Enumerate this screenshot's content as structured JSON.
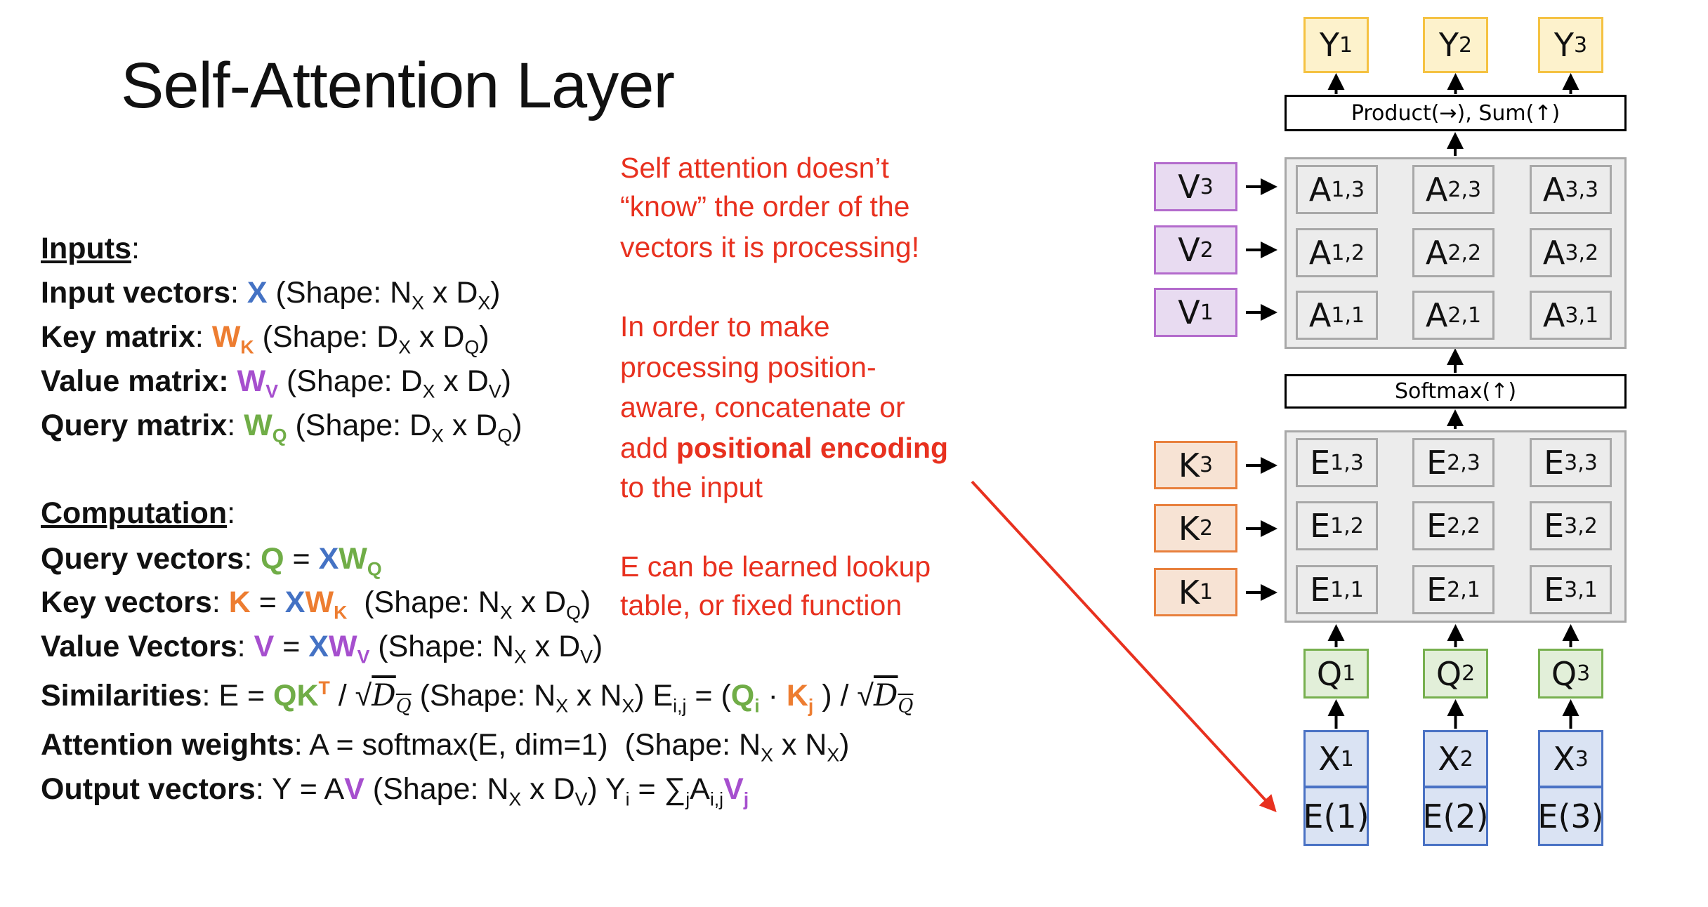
{
  "title": "Self-Attention Layer",
  "colors": {
    "blue": "#4472c4",
    "orange": "#ed7d31",
    "purple": "#a64fce",
    "green": "#70ad47",
    "red": "#e8311f"
  },
  "left_text": {
    "lines": [
      [
        {
          "t": "Inputs",
          "b": 1,
          "u": 1
        },
        {
          "t": ":"
        }
      ],
      [
        {
          "t": "Input vectors",
          "b": 1
        },
        {
          "t": ": "
        },
        {
          "t": "X",
          "b": 1,
          "c": "#4472c4"
        },
        {
          "t": " (Shape: N"
        },
        {
          "t": "X",
          "sub": 1
        },
        {
          "t": " x D"
        },
        {
          "t": "X",
          "sub": 1
        },
        {
          "t": ")"
        }
      ],
      [
        {
          "t": "Key matrix",
          "b": 1
        },
        {
          "t": ": "
        },
        {
          "t": "W",
          "b": 1,
          "c": "#ed7d31"
        },
        {
          "t": "K",
          "b": 1,
          "sub": 1,
          "c": "#ed7d31"
        },
        {
          "t": " (Shape: D"
        },
        {
          "t": "X",
          "sub": 1
        },
        {
          "t": " x D"
        },
        {
          "t": "Q",
          "sub": 1
        },
        {
          "t": ")"
        }
      ],
      [
        {
          "t": "Value matrix:",
          "b": 1
        },
        {
          "t": " "
        },
        {
          "t": "W",
          "b": 1,
          "c": "#a64fce"
        },
        {
          "t": "V",
          "b": 1,
          "sub": 1,
          "c": "#a64fce"
        },
        {
          "t": " (Shape: D"
        },
        {
          "t": "X",
          "sub": 1
        },
        {
          "t": " x D"
        },
        {
          "t": "V",
          "sub": 1
        },
        {
          "t": ")"
        }
      ],
      [
        {
          "t": "Query matrix",
          "b": 1
        },
        {
          "t": ": "
        },
        {
          "t": "W",
          "b": 1,
          "c": "#70ad47"
        },
        {
          "t": "Q",
          "b": 1,
          "sub": 1,
          "c": "#70ad47"
        },
        {
          "t": " (Shape: D"
        },
        {
          "t": "X",
          "sub": 1
        },
        {
          "t": " x D"
        },
        {
          "t": "Q",
          "sub": 1
        },
        {
          "t": ")"
        }
      ],
      [
        {
          "t": "Computation",
          "b": 1,
          "u": 1
        },
        {
          "t": ":"
        }
      ],
      [
        {
          "t": "Query vectors",
          "b": 1
        },
        {
          "t": ": "
        },
        {
          "t": "Q",
          "b": 1,
          "c": "#70ad47"
        },
        {
          "t": " = "
        },
        {
          "t": "X",
          "b": 1,
          "c": "#4472c4"
        },
        {
          "t": "W",
          "b": 1,
          "c": "#70ad47"
        },
        {
          "t": "Q",
          "b": 1,
          "sub": 1,
          "c": "#70ad47"
        }
      ],
      [
        {
          "t": "Key vectors",
          "b": 1
        },
        {
          "t": ": "
        },
        {
          "t": "K",
          "b": 1,
          "c": "#ed7d31"
        },
        {
          "t": " = "
        },
        {
          "t": "X",
          "b": 1,
          "c": "#4472c4"
        },
        {
          "t": "W",
          "b": 1,
          "c": "#ed7d31"
        },
        {
          "t": "K",
          "b": 1,
          "sub": 1,
          "c": "#ed7d31"
        },
        {
          "t": "  (Shape: N"
        },
        {
          "t": "X",
          "sub": 1
        },
        {
          "t": " x D"
        },
        {
          "t": "Q",
          "sub": 1
        },
        {
          "t": ")"
        }
      ],
      [
        {
          "t": "Value Vectors",
          "b": 1
        },
        {
          "t": ": "
        },
        {
          "t": "V",
          "b": 1,
          "c": "#a64fce"
        },
        {
          "t": " = "
        },
        {
          "t": "X",
          "b": 1,
          "c": "#4472c4"
        },
        {
          "t": "W",
          "b": 1,
          "c": "#a64fce"
        },
        {
          "t": "V",
          "b": 1,
          "sub": 1,
          "c": "#a64fce"
        },
        {
          "t": " (Shape: N"
        },
        {
          "t": "X",
          "sub": 1
        },
        {
          "t": " x D"
        },
        {
          "t": "V",
          "sub": 1
        },
        {
          "t": ")"
        }
      ],
      [
        {
          "t": "Similarities",
          "b": 1
        },
        {
          "t": ": E = "
        },
        {
          "t": "QK",
          "b": 1,
          "c": "#70ad47"
        },
        {
          "t": "T",
          "b": 1,
          "sup": 1,
          "c": "#ed7d31"
        },
        {
          "t": " / √"
        },
        {
          "t": "D",
          "it": 1,
          "ov": 1
        },
        {
          "t": "Q",
          "it": 1,
          "ov": 1,
          "sub": 1
        },
        {
          "t": " (Shape: N"
        },
        {
          "t": "X",
          "sub": 1
        },
        {
          "t": " x N"
        },
        {
          "t": "X",
          "sub": 1
        },
        {
          "t": ") E"
        },
        {
          "t": "i,j",
          "sub": 1
        },
        {
          "t": " = ("
        },
        {
          "t": "Q",
          "b": 1,
          "c": "#70ad47"
        },
        {
          "t": "i",
          "b": 1,
          "sub": 1,
          "c": "#70ad47"
        },
        {
          "t": " · "
        },
        {
          "t": "K",
          "b": 1,
          "c": "#ed7d31"
        },
        {
          "t": "j",
          "b": 1,
          "sub": 1,
          "c": "#ed7d31"
        },
        {
          "t": " ) / √"
        },
        {
          "t": "D",
          "it": 1,
          "ov": 1
        },
        {
          "t": "Q",
          "it": 1,
          "ov": 1,
          "sub": 1
        }
      ],
      [
        {
          "t": "Attention weights",
          "b": 1
        },
        {
          "t": ": A = softmax(E, dim=1)  (Shape: N"
        },
        {
          "t": "X",
          "sub": 1
        },
        {
          "t": " x N"
        },
        {
          "t": "X",
          "sub": 1
        },
        {
          "t": ")"
        }
      ],
      [
        {
          "t": "Output vectors",
          "b": 1
        },
        {
          "t": ": Y = A"
        },
        {
          "t": "V",
          "b": 1,
          "c": "#a64fce"
        },
        {
          "t": " (Shape: N"
        },
        {
          "t": "X",
          "sub": 1
        },
        {
          "t": " x D"
        },
        {
          "t": "V",
          "sub": 1
        },
        {
          "t": ") Y"
        },
        {
          "t": "i",
          "sub": 1
        },
        {
          "t": " = ∑"
        },
        {
          "t": "j",
          "sub": 1
        },
        {
          "t": "A"
        },
        {
          "t": "i,j",
          "sub": 1
        },
        {
          "t": "V",
          "b": 1,
          "c": "#a64fce"
        },
        {
          "t": "j",
          "b": 1,
          "sub": 1,
          "c": "#a64fce"
        }
      ]
    ]
  },
  "notes": {
    "lines": [
      [
        {
          "t": "Self attention doesn’t"
        }
      ],
      [
        {
          "t": "“know” the order of the"
        }
      ],
      [
        {
          "t": "vectors it is processing!"
        }
      ],
      [
        {
          "t": "In order to make"
        }
      ],
      [
        {
          "t": "processing position-"
        }
      ],
      [
        {
          "t": "aware, concatenate or"
        }
      ],
      [
        {
          "t": "add "
        },
        {
          "t": "positional encoding",
          "b": 1
        }
      ],
      [
        {
          "t": "to the input"
        }
      ],
      [
        {
          "t": "E can be learned lookup"
        }
      ],
      [
        {
          "t": "table, or fixed function"
        }
      ]
    ]
  },
  "diagram": {
    "outputs": [
      {
        "m": "Y",
        "s": "1"
      },
      {
        "m": "Y",
        "s": "2"
      },
      {
        "m": "Y",
        "s": "3"
      }
    ],
    "product_label": "Product(→),   Sum(↑)",
    "values": [
      {
        "m": "V",
        "s": "3"
      },
      {
        "m": "V",
        "s": "2"
      },
      {
        "m": "V",
        "s": "1"
      }
    ],
    "attention": [
      [
        {
          "m": "A",
          "s": "1,3"
        },
        {
          "m": "A",
          "s": "2,3"
        },
        {
          "m": "A",
          "s": "3,3"
        }
      ],
      [
        {
          "m": "A",
          "s": "1,2"
        },
        {
          "m": "A",
          "s": "2,2"
        },
        {
          "m": "A",
          "s": "3,2"
        }
      ],
      [
        {
          "m": "A",
          "s": "1,1"
        },
        {
          "m": "A",
          "s": "2,1"
        },
        {
          "m": "A",
          "s": "3,1"
        }
      ]
    ],
    "softmax_label": "Softmax(↑)",
    "keys": [
      {
        "m": "K",
        "s": "3"
      },
      {
        "m": "K",
        "s": "2"
      },
      {
        "m": "K",
        "s": "1"
      }
    ],
    "similarities": [
      [
        {
          "m": "E",
          "s": "1,3"
        },
        {
          "m": "E",
          "s": "2,3"
        },
        {
          "m": "E",
          "s": "3,3"
        }
      ],
      [
        {
          "m": "E",
          "s": "1,2"
        },
        {
          "m": "E",
          "s": "2,2"
        },
        {
          "m": "E",
          "s": "3,2"
        }
      ],
      [
        {
          "m": "E",
          "s": "1,1"
        },
        {
          "m": "E",
          "s": "2,1"
        },
        {
          "m": "E",
          "s": "3,1"
        }
      ]
    ],
    "queries": [
      {
        "m": "Q",
        "s": "1"
      },
      {
        "m": "Q",
        "s": "2"
      },
      {
        "m": "Q",
        "s": "3"
      }
    ],
    "inputs": [
      {
        "m": "X",
        "s": "1"
      },
      {
        "m": "X",
        "s": "2"
      },
      {
        "m": "X",
        "s": "3"
      }
    ],
    "encodings": [
      "E(1)",
      "E(2)",
      "E(3)"
    ],
    "box_colors": {
      "Y": {
        "fill": "#fdf2cc",
        "border": "#f5c242"
      },
      "V": {
        "fill": "#e8dbf1",
        "border": "#b36bcc"
      },
      "K": {
        "fill": "#f7e3d4",
        "border": "#e8803d"
      },
      "Q": {
        "fill": "#e2efd9",
        "border": "#77b04f"
      },
      "X": {
        "fill": "#dae3f3",
        "border": "#4a72c4"
      }
    }
  }
}
